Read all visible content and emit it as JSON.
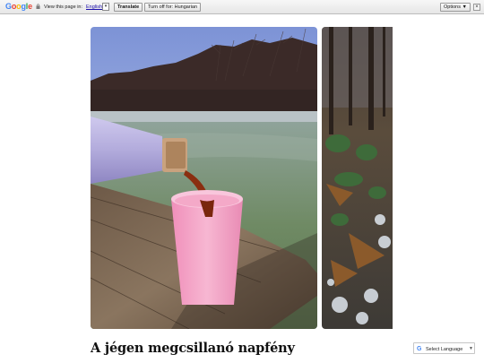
{
  "translate_bar": {
    "logo": "Google",
    "prompt": "View this page in:",
    "language": "English",
    "translate_label": "Translate",
    "turn_off_label": "Turn off for: Hungarian",
    "options_label": "Options ▼",
    "close_label": "×"
  },
  "gallery": {
    "main_photo": "thermos-pouring-tea-by-frozen-lake",
    "side_photo": "frosted-forest-floor-leaves"
  },
  "article": {
    "title": "A jégen megcsillanó napfény"
  },
  "language_selector": {
    "icon": "G",
    "label": "Select Language",
    "caret": "▼"
  },
  "colors": {
    "bar_bg": "#eeeeee",
    "link": "#1a0dab",
    "cup_pink": "#f4a9c8",
    "thermos_lilac": "#b7b1df"
  }
}
